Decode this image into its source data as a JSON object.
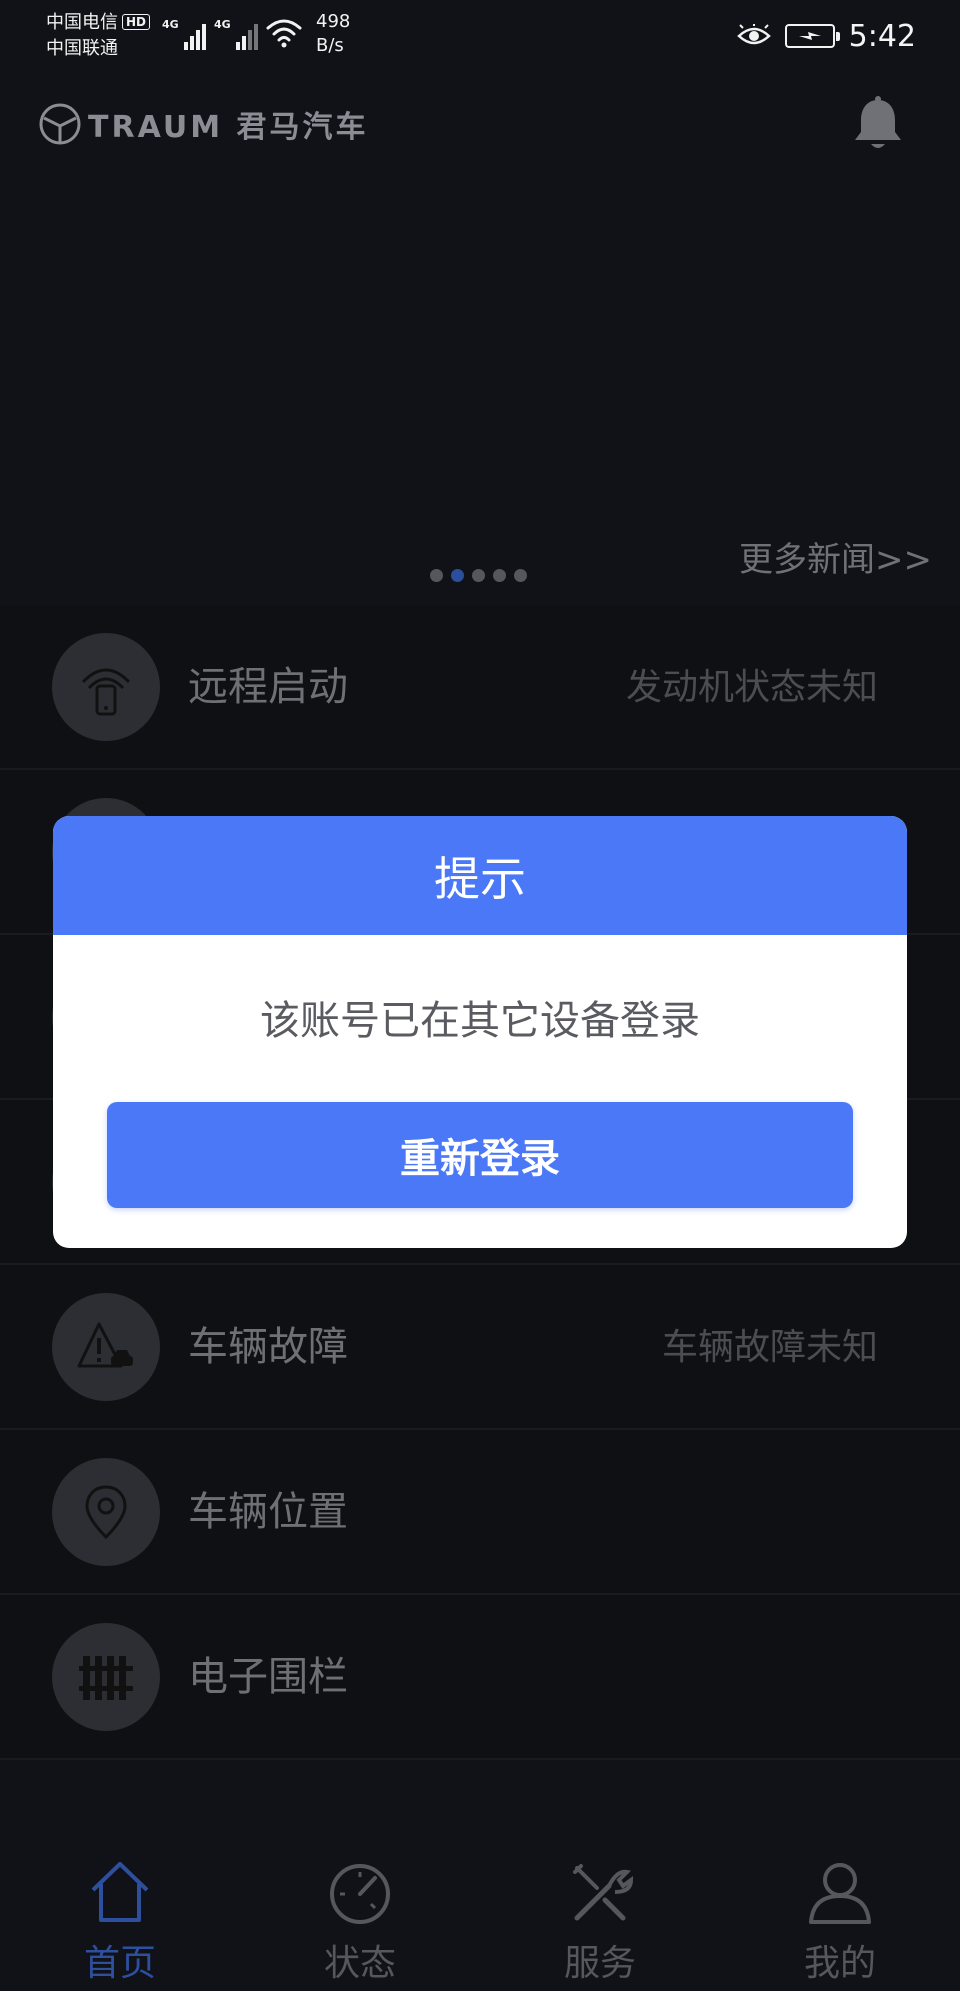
{
  "status_bar": {
    "carrier_1": "中国电信",
    "hd": "HD",
    "carrier_2": "中国联通",
    "signal_gen_1": "4G",
    "signal_gen_2": "4G",
    "net_speed_value": "498",
    "net_speed_unit": "B/s",
    "time": "5:42"
  },
  "header": {
    "brand_logo_text": "TRAUM 君马汽车",
    "icons": [
      "brand-logo-icon",
      "bell-icon"
    ]
  },
  "banner": {
    "more_news": "更多新闻>>",
    "dot_count": 5,
    "active_dot": 1
  },
  "features": [
    {
      "label": "远程启动",
      "status": "发动机状态未知",
      "icon": "remote-start-icon"
    },
    {
      "label": "",
      "status": "",
      "icon": "unknown-icon"
    },
    {
      "label": "",
      "status": "",
      "icon": "unknown-icon"
    },
    {
      "label": "",
      "status": "",
      "icon": "unknown-icon"
    },
    {
      "label": "车辆故障",
      "status": "车辆故障未知",
      "icon": "vehicle-fault-icon"
    },
    {
      "label": "车辆位置",
      "status": "",
      "icon": "location-pin-icon"
    },
    {
      "label": "电子围栏",
      "status": "",
      "icon": "fence-icon"
    }
  ],
  "dialog": {
    "title": "提示",
    "message": "该账号已在其它设备登录",
    "button": "重新登录"
  },
  "bottom_nav": {
    "items": [
      {
        "label": "首页",
        "icon": "home-icon",
        "active": true
      },
      {
        "label": "状态",
        "icon": "speedometer-icon",
        "active": false
      },
      {
        "label": "服务",
        "icon": "tools-icon",
        "active": false
      },
      {
        "label": "我的",
        "icon": "user-icon",
        "active": false
      }
    ]
  },
  "colors": {
    "background": "#111217",
    "accent": "#4b78f6",
    "nav_active": "#2d4f9e"
  }
}
